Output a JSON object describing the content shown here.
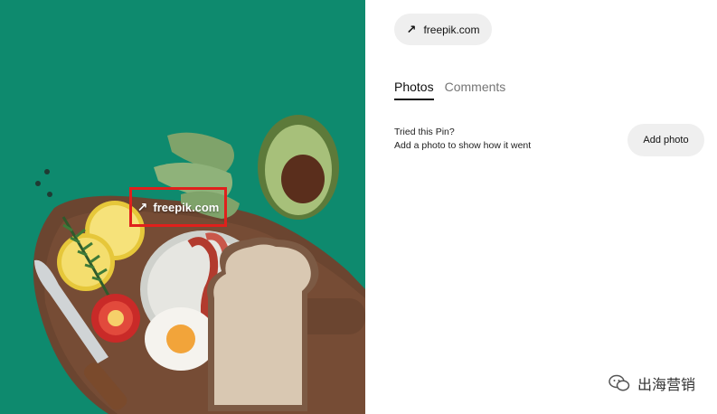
{
  "pin": {
    "source_overlay_label": "freepik.com",
    "overlay_arrow": "↗"
  },
  "panel": {
    "source_label": "freepik.com",
    "source_arrow": "↗",
    "tabs": [
      {
        "label": "Photos",
        "active": true
      },
      {
        "label": "Comments",
        "active": false
      }
    ],
    "tried_title": "Tried this Pin?",
    "tried_desc": "Add a photo to show how it went",
    "add_photo_label": "Add photo"
  },
  "watermark": {
    "text": "出海营销",
    "icon": "wechat-icon"
  },
  "colors": {
    "image_background": "#0e8a6e",
    "highlight_border": "#e0201c"
  }
}
